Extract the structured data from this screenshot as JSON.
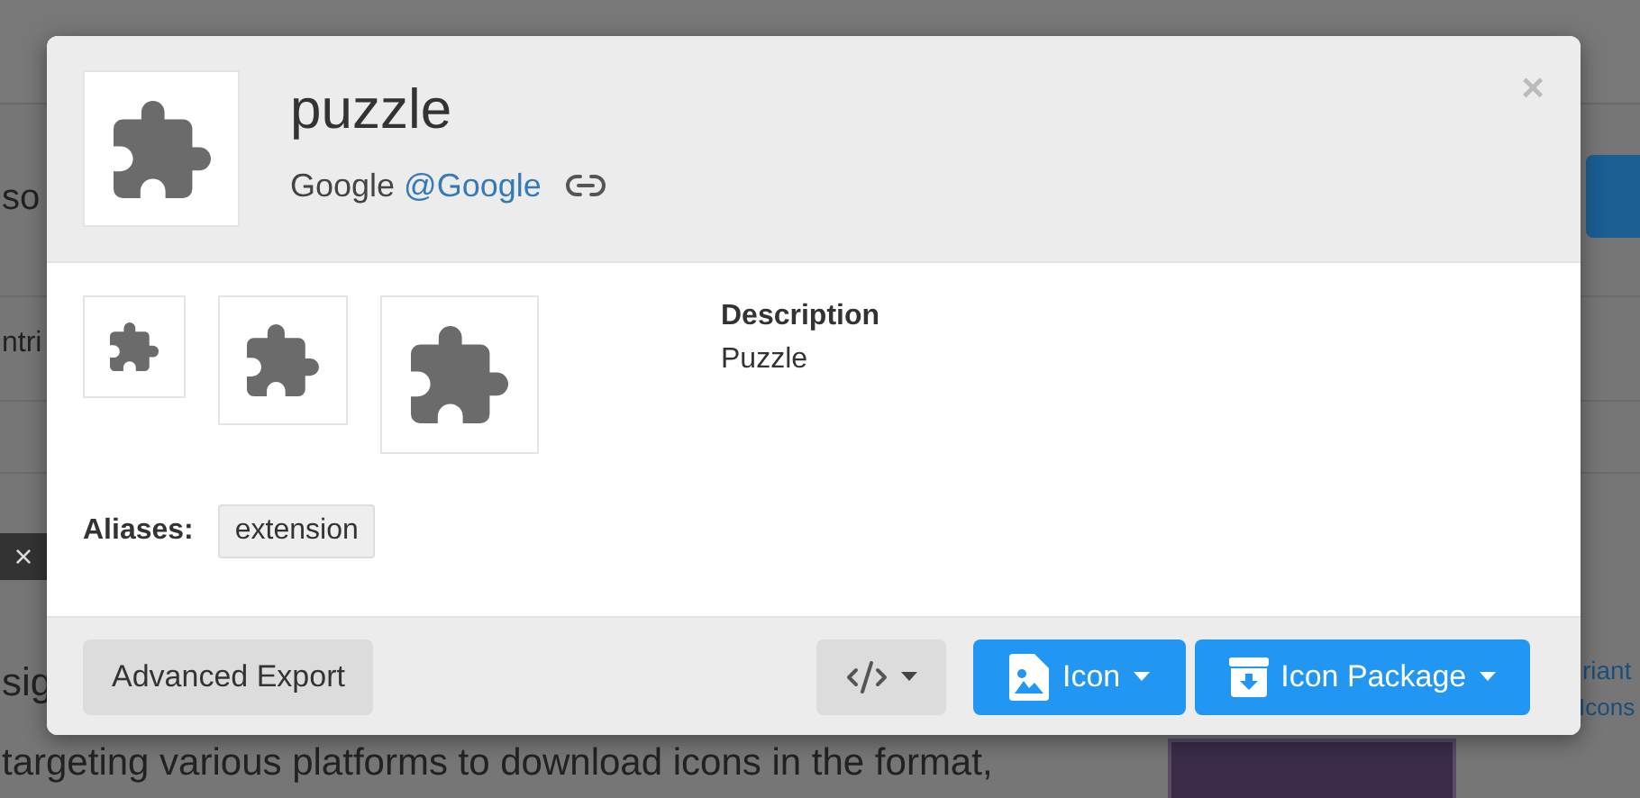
{
  "background": {
    "fragments": [
      {
        "text": "so"
      },
      {
        "text": "ntri"
      },
      {
        "text": "sig"
      },
      {
        "text": "targeting various platforms to download icons in the format,"
      },
      {
        "text": "riant"
      },
      {
        "text": "Icons"
      }
    ],
    "notice_close": "×"
  },
  "dialog": {
    "title": "puzzle",
    "author": "Google",
    "author_handle": "@Google",
    "close": "×",
    "description_label": "Description",
    "description": "Puzzle",
    "aliases_label": "Aliases:",
    "aliases": [
      "extension"
    ],
    "buttons": [
      {
        "kind": "plain",
        "label": "Advanced Export"
      },
      {
        "kind": "code"
      },
      {
        "kind": "icon",
        "label": "Icon"
      },
      {
        "kind": "package",
        "label": "Icon Package"
      }
    ]
  }
}
